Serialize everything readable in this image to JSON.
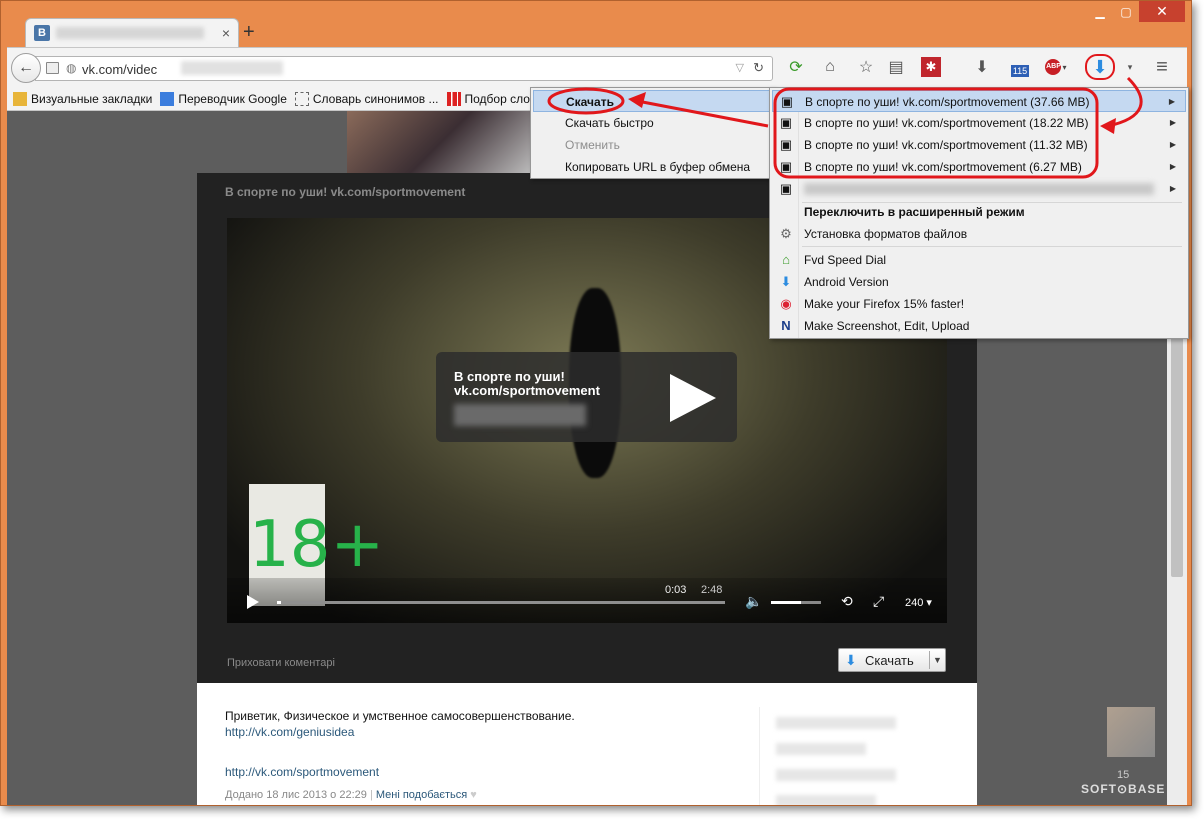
{
  "tab": {
    "favicon": "B",
    "title": ""
  },
  "urlbar": {
    "prefix": "vk.com/videc"
  },
  "bookmarks": [
    {
      "label": "Визуальные закладки",
      "icon": "bookmark-icon"
    },
    {
      "label": "Переводчик Google",
      "icon": "translate-icon"
    },
    {
      "label": "Словарь синонимов ...",
      "icon": "dictionary-icon"
    },
    {
      "label": "Подбор сло",
      "icon": "chart-icon"
    }
  ],
  "video": {
    "card_title": "В спорте по уши! vk.com/sportmovement",
    "overlay_line1": "В спорте по уши!",
    "overlay_line2": "vk.com/sportmovement",
    "rating": "18+",
    "current_time": "0:03",
    "duration": "2:48",
    "quality": "240",
    "progress": 0.01,
    "volume": 0.6
  },
  "hide_comments": "Приховати коментарі",
  "download_button": {
    "label": "Скачать"
  },
  "description": {
    "text": "Приветик, Физическое и умственное самосовершенствование.",
    "link1": "http://vk.com/geniusidea",
    "link2": "http://vk.com/sportmovement",
    "date": "Додано 18 лис 2013 о 22:29",
    "like": "Мені подобається"
  },
  "submenu": {
    "download": "Скачать",
    "download_fast": "Скачать быстро",
    "cancel": "Отменить",
    "copy_url": "Копировать URL в буфер обмена"
  },
  "mainmenu": {
    "files": [
      "В спорте по уши! vk.com/sportmovement (37.66 MB)",
      "В спорте по уши! vk.com/sportmovement (18.22 MB)",
      "В спорте по уши! vk.com/sportmovement (11.32 MB)",
      "В спорте по уши! vk.com/sportmovement (6.27 MB)"
    ],
    "advanced": "Переключить в расширенный режим",
    "formats": "Установка форматов файлов",
    "fvd": "Fvd Speed Dial",
    "android": "Android Version",
    "firefox": "Make your Firefox 15% faster!",
    "screenshot": "Make Screenshot, Edit, Upload"
  },
  "toolbar": {
    "badge": "115",
    "abp": "ABP"
  },
  "sidebar_count": "15",
  "watermark": "SOFT⊙BASE",
  "colors": {
    "accent": "#e1171b",
    "window_frame": "#e98b4c",
    "highlight": "#c5d9f1",
    "link": "#2b587a"
  }
}
